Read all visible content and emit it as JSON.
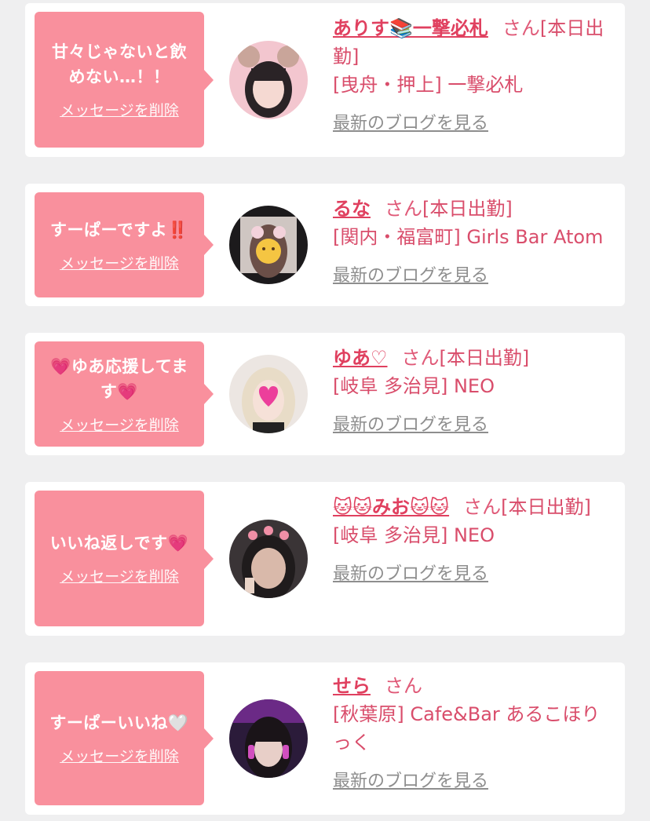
{
  "delete_label": "メッセージを削除",
  "blog_label": "最新のブログを見る",
  "san": "さん",
  "colors": {
    "accent": "#f9909d",
    "name": "#e0405f",
    "link_gray": "#8e8e8e",
    "background": "#efeff0"
  },
  "items": [
    {
      "message": "甘々じゃないと飲めない…！！",
      "name": "ありす📚一撃必札",
      "suffix": "[本日出勤]",
      "place": "[曳舟・押上] 一撃必札"
    },
    {
      "message": "すーぱーですよ‼️",
      "name": "るな",
      "suffix": "[本日出勤]",
      "place": "[関内・福富町] Girls Bar Atom"
    },
    {
      "message": "💗ゆあ応援してます💗",
      "name": "ゆあ♡",
      "suffix": "[本日出勤]",
      "place": "[岐阜 多治見] NEO"
    },
    {
      "message": "いいね返しです💗",
      "name": "🐱🐱みお🐱🐱",
      "suffix": "[本日出勤]",
      "place": "[岐阜 多治見] NEO"
    },
    {
      "message": "すーぱーいいね🤍",
      "name": "せら",
      "suffix": "",
      "place": "[秋葉原] Cafe&Bar あるこほりっく"
    }
  ]
}
